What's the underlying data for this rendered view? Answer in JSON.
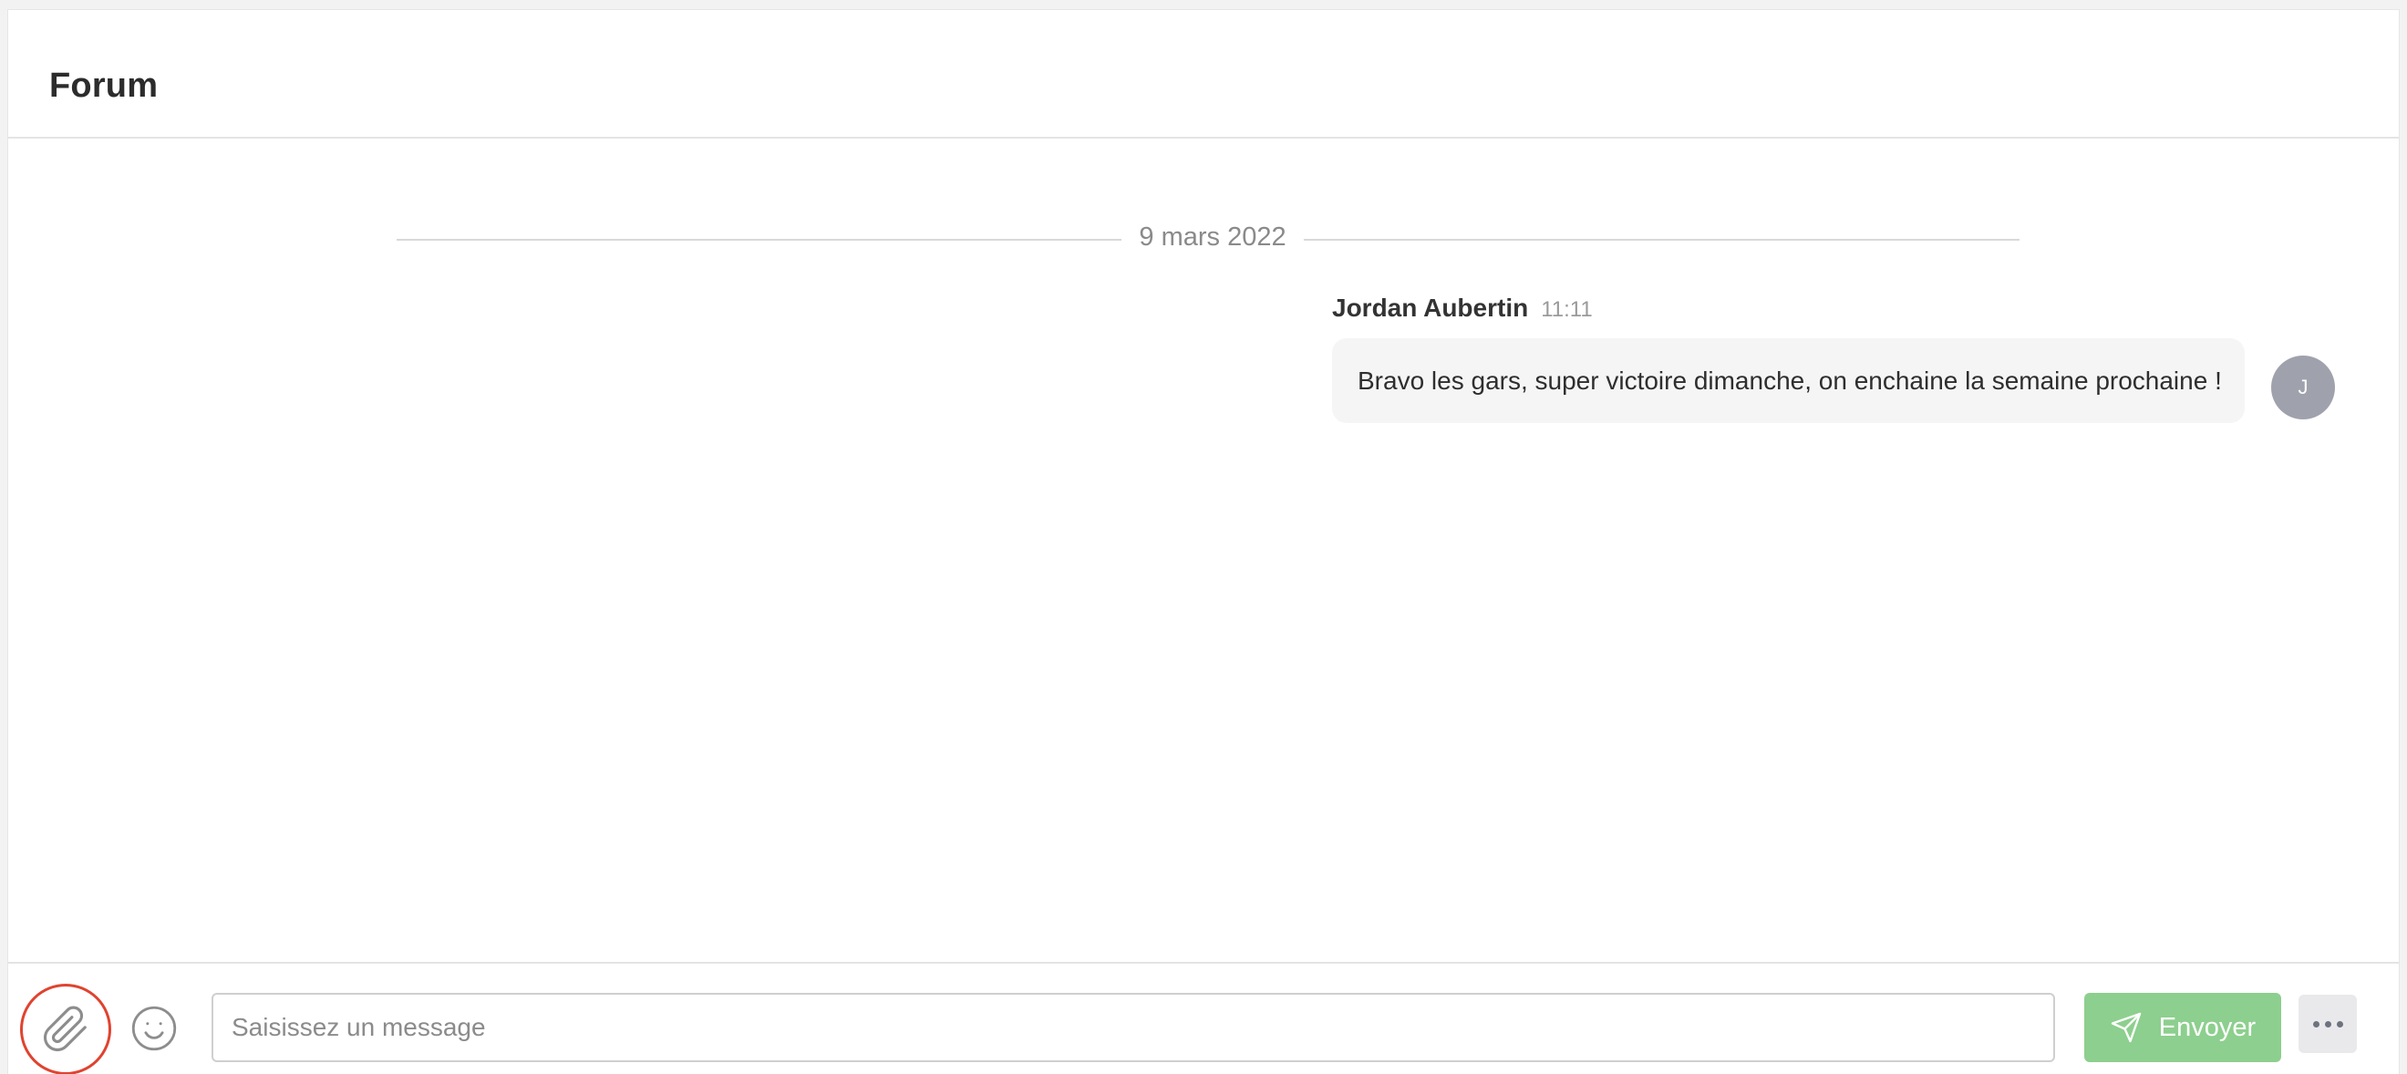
{
  "page": {
    "title": "Forum"
  },
  "thread": {
    "date_separator": "9 mars 2022",
    "messages": [
      {
        "author": "Jordan Aubertin",
        "time": "11:11",
        "text": "Bravo les gars, super victoire dimanche, on enchaine la semaine prochaine !",
        "avatar_initial": "J",
        "avatar_color": "#9fa1ac"
      }
    ]
  },
  "composer": {
    "attach_icon": "paperclip-icon",
    "emoji_icon": "smiley-icon",
    "input_placeholder": "Saisissez un message",
    "input_value": "",
    "send_label": "Envoyer",
    "send_icon": "paper-plane-icon",
    "more_icon": "ellipsis-icon",
    "send_color": "#8dcf8e",
    "highlight_color": "#e0432f"
  }
}
